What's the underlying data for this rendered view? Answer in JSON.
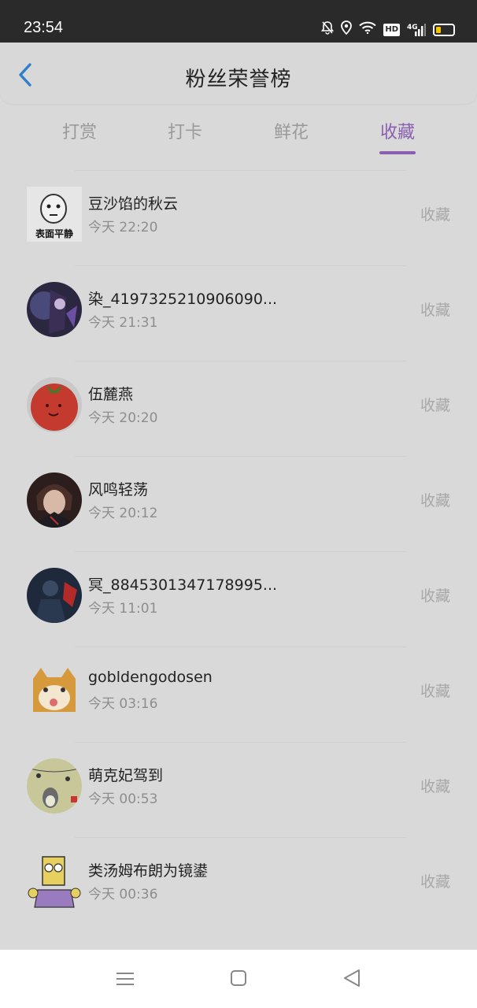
{
  "status_bar": {
    "time": "23:54",
    "icons": [
      "bell-off-icon",
      "location-icon",
      "wifi-icon",
      "hd-icon",
      "signal-4g-icon",
      "battery-icon"
    ],
    "hd_label": "HD",
    "network_label": "4G"
  },
  "header": {
    "title": "粉丝荣誉榜",
    "back_icon": "chevron-left-icon"
  },
  "tabs": [
    {
      "label": "打赏",
      "active": false
    },
    {
      "label": "打卡",
      "active": false
    },
    {
      "label": "鲜花",
      "active": false
    },
    {
      "label": "收藏",
      "active": true
    }
  ],
  "colors": {
    "accent": "#8a5fb0",
    "back_arrow": "#2f7fc9",
    "background": "#d9d9d9"
  },
  "fans": [
    {
      "name": "豆沙馅的秋云",
      "time": "今天 22:20",
      "action": "收藏",
      "avatar": "meme-face-avatar",
      "avatar_caption": "表面平静"
    },
    {
      "name": "染_4197325210906090...",
      "time": "今天 21:31",
      "action": "收藏",
      "avatar": "anime-character-avatar"
    },
    {
      "name": "伍麓燕",
      "time": "今天 20:20",
      "action": "收藏",
      "avatar": "tomato-avatar"
    },
    {
      "name": "风鸣轻荡",
      "time": "今天 20:12",
      "action": "收藏",
      "avatar": "anime-boy-avatar"
    },
    {
      "name": "冥_8845301347178995...",
      "time": "今天 11:01",
      "action": "收藏",
      "avatar": "dark-figure-avatar"
    },
    {
      "name": "gobldengodosen",
      "time": "今天 03:16",
      "action": "收藏",
      "avatar": "cartoon-cat-avatar"
    },
    {
      "name": "萌克妃驾到",
      "time": "今天 00:53",
      "action": "收藏",
      "avatar": "totoro-avatar"
    },
    {
      "name": "类汤姆布朗为镜鍙",
      "time": "今天 00:36",
      "action": "收藏",
      "avatar": "cartoon-bart-avatar"
    }
  ],
  "nav_bar": {
    "buttons": [
      "menu-icon",
      "home-square-icon",
      "back-triangle-icon"
    ]
  }
}
